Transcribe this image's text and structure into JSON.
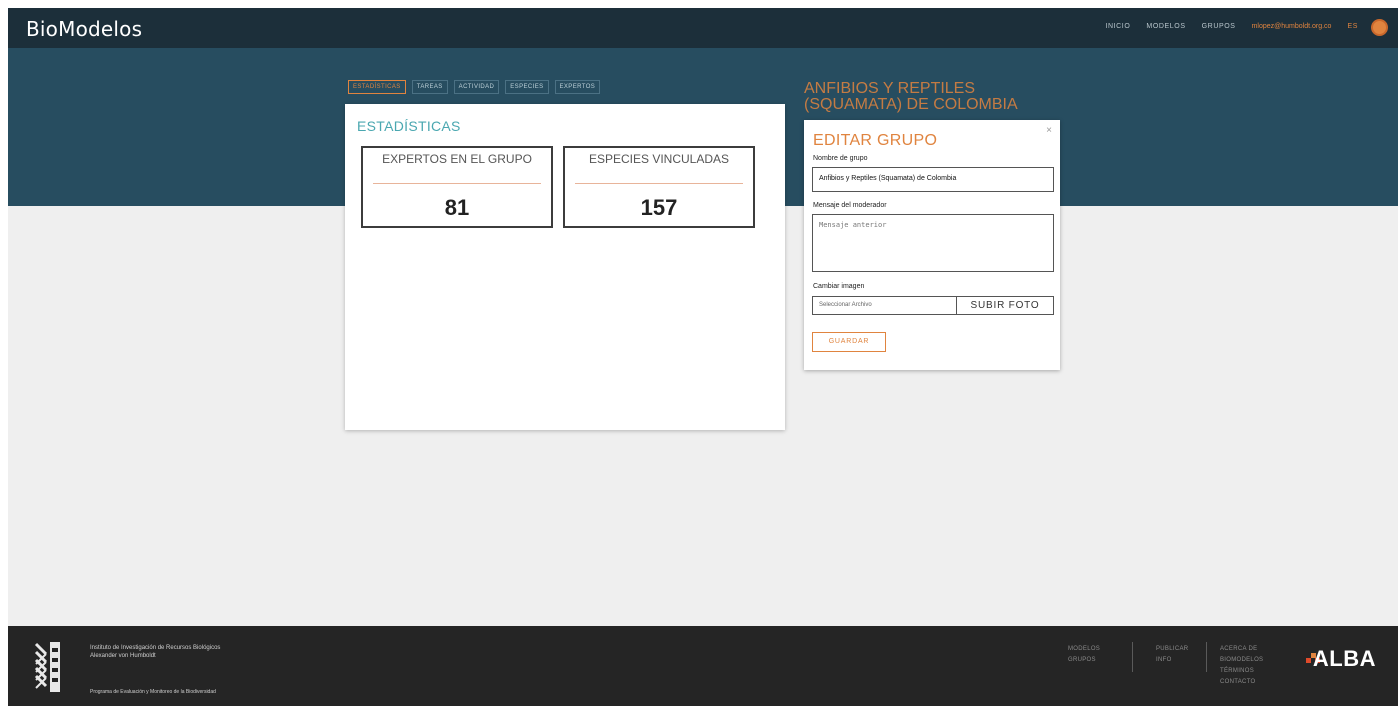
{
  "app": {
    "brand": "BioModelos"
  },
  "nav": {
    "items": [
      "INICIO",
      "MODELOS",
      "GRUPOS"
    ],
    "email": "mlopez@humboldt.org.co",
    "lang": "ES"
  },
  "tabs": [
    "ESTADÍSTICAS",
    "TAREAS",
    "ACTIVIDAD",
    "ESPECIES",
    "EXPERTOS"
  ],
  "group_title": "ANFIBIOS Y REPTILES (SQUAMATA) DE COLOMBIA",
  "stats_panel": {
    "title": "ESTADÍSTICAS",
    "cards": [
      {
        "label": "EXPERTOS EN EL GRUPO",
        "value": "81"
      },
      {
        "label": "ESPECIES VINCULADAS",
        "value": "157"
      }
    ]
  },
  "edit_modal": {
    "title": "EDITAR GRUPO",
    "close": "×",
    "name_label": "Nombre de grupo",
    "name_value": "Anfibios y Reptiles (Squamata) de Colombia",
    "message_label": "Mensaje del moderador",
    "message_placeholder": "Mensaje anterior",
    "image_label": "Cambiar imagen",
    "file_placeholder": "Seleccionar Archivo",
    "upload_label": "SUBIR FOTO",
    "save_label": "GUARDAR"
  },
  "footer": {
    "org_line1": "Instituto de Investigación de Recursos Biológicos",
    "org_line2": "Alexander von Humboldt",
    "program": "Programa de Evaluación y Monitoreo de la Biodiversidad",
    "col1": [
      "MODELOS",
      "GRUPOS"
    ],
    "col2": [
      "PUBLICAR",
      "INFO"
    ],
    "col3": [
      "ACERCA DE BIOMODELOS",
      "TÉRMINOS",
      "CONTACTO"
    ],
    "partner": "ALBA"
  },
  "colors": {
    "accent": "#e0843f",
    "teal": "#4aa7b0",
    "header": "#274d60",
    "topbar": "#1c2f3a"
  }
}
